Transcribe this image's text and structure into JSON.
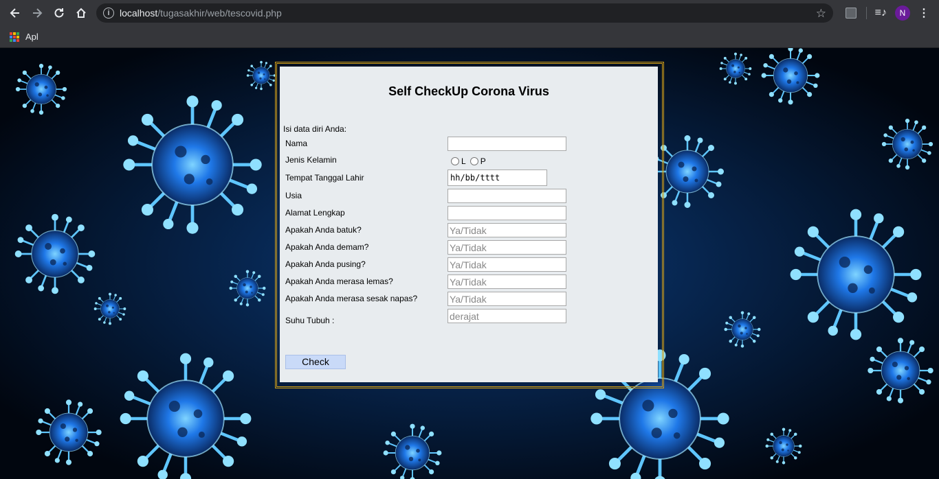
{
  "browser": {
    "url_host": "localhost",
    "url_path": "/tugasakhir/web/tescovid.php",
    "bookmarks": [
      {
        "label": "Apl"
      }
    ],
    "profile_initial": "N"
  },
  "form": {
    "title": "Self CheckUp Corona Virus",
    "intro": "Isi data diri Anda:",
    "fields": {
      "nama": {
        "label": "Nama",
        "value": "",
        "placeholder": ""
      },
      "jenis_kelamin": {
        "label": "Jenis Kelamin",
        "options": [
          "L",
          "P"
        ]
      },
      "ttl": {
        "label": "Tempat Tanggal Lahir",
        "value": "hh/bb/tttt"
      },
      "usia": {
        "label": "Usia",
        "value": "",
        "placeholder": ""
      },
      "alamat": {
        "label": "Alamat Lengkap",
        "value": "",
        "placeholder": ""
      },
      "batuk": {
        "label": "Apakah Anda batuk?",
        "placeholder": "Ya/Tidak"
      },
      "demam": {
        "label": "Apakah Anda demam?",
        "placeholder": "Ya/Tidak"
      },
      "pusing": {
        "label": "Apakah Anda pusing?",
        "placeholder": "Ya/Tidak"
      },
      "lemas": {
        "label": "Apakah Anda merasa lemas?",
        "placeholder": "Ya/Tidak"
      },
      "sesak": {
        "label": "Apakah Anda merasa sesak napas?",
        "placeholder": "Ya/Tidak"
      },
      "suhu": {
        "label": "Suhu Tubuh :",
        "placeholder": "derajat"
      }
    },
    "submit_label": "Check"
  },
  "colors": {
    "frame_border": "#d4a017",
    "panel_bg": "#e8ecef",
    "button_bg": "#c9daf8",
    "virus_glow": "#2f8fff"
  }
}
